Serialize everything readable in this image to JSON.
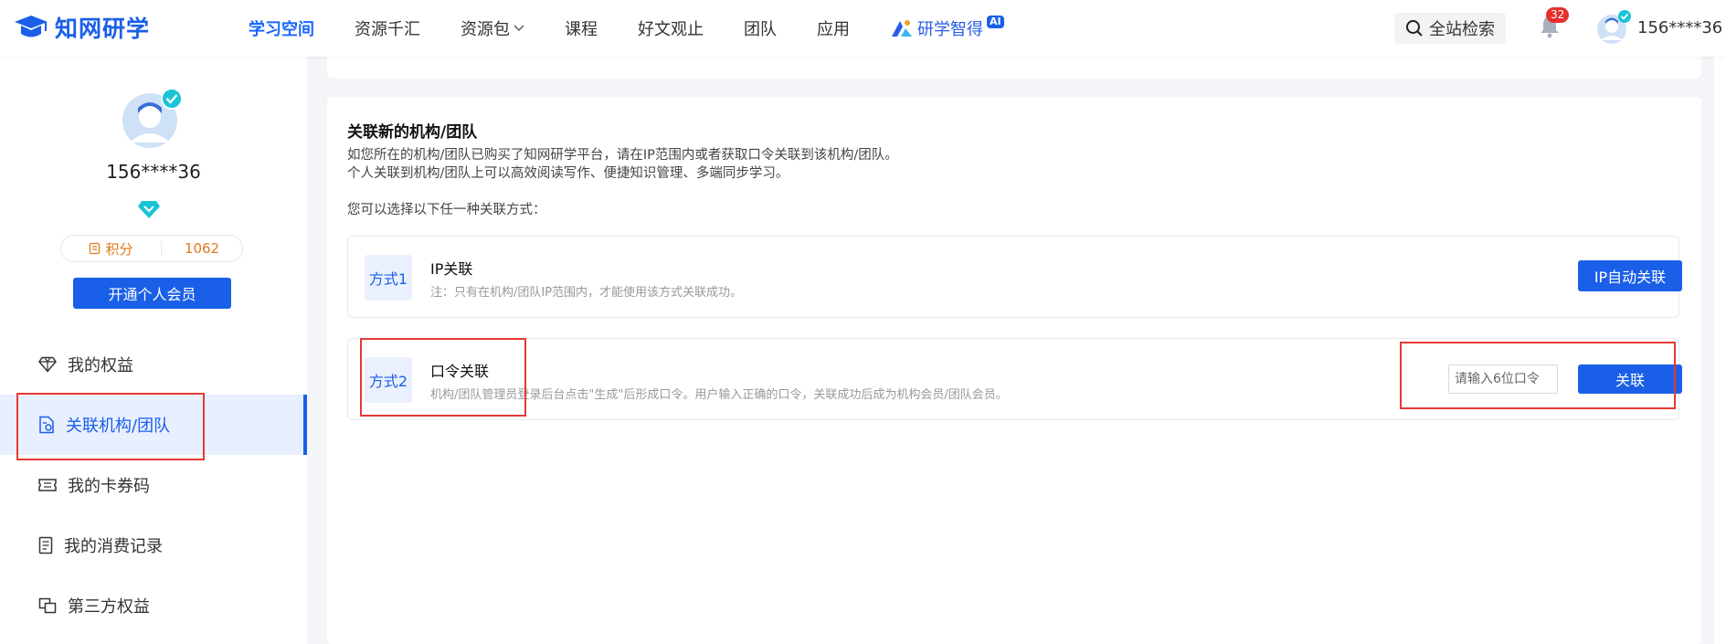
{
  "header": {
    "logo_text": "知网研学",
    "nav": [
      {
        "label": "学习空间",
        "active": true
      },
      {
        "label": "资源千汇"
      },
      {
        "label": "资源包",
        "dropdown": true
      },
      {
        "label": "课程"
      },
      {
        "label": "好文观止"
      },
      {
        "label": "团队"
      },
      {
        "label": "应用"
      }
    ],
    "ai_label": "研学智得",
    "ai_badge": "AI",
    "search_label": "全站检索",
    "notif_count": "32",
    "username": "156****36"
  },
  "sidebar": {
    "username": "156****36",
    "points_label": "积分",
    "points_value": "1062",
    "open_vip": "开通个人会员",
    "menu": [
      {
        "label": "我的权益",
        "icon": "diamond-icon"
      },
      {
        "label": "关联机构/团队",
        "icon": "link-doc-icon",
        "active": true
      },
      {
        "label": "我的卡券码",
        "icon": "ticket-icon"
      },
      {
        "label": "我的消费记录",
        "icon": "receipt-icon"
      },
      {
        "label": "第三方权益",
        "icon": "copy-icon"
      }
    ]
  },
  "main": {
    "title": "关联新的机构/团队",
    "desc1": "如您所在的机构/团队已购买了知网研学平台，请在IP范围内或者获取口令关联到该机构/团队。",
    "desc2": "个人关联到机构/团队上可以高效阅读写作、便捷知识管理、多端同步学习。",
    "desc3": "您可以选择以下任一种关联方式：",
    "method1": {
      "tag": "方式1",
      "title": "IP关联",
      "note": "注：只有在机构/团队IP范围内，才能使用该方式关联成功。",
      "button": "IP自动关联"
    },
    "method2": {
      "tag": "方式2",
      "title": "口令关联",
      "note": "机构/团队管理员登录后台点击\"生成\"后形成口令。用户输入正确的口令，关联成功后成为机构会员/团队会员。",
      "placeholder": "请输入6位口令",
      "button": "关联"
    }
  },
  "colors": {
    "primary": "#1a5fe8",
    "highlight": "#e53935",
    "points": "#e07a1c"
  }
}
